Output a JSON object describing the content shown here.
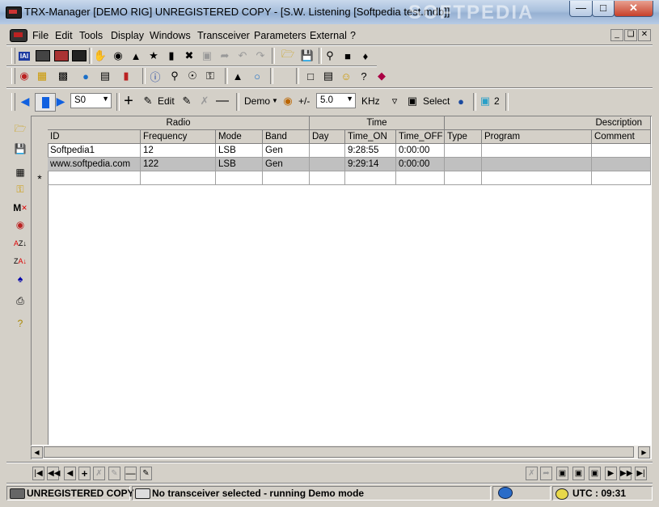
{
  "window": {
    "title": "TRX-Manager [DEMO RIG] UNREGISTERED COPY - [S.W. Listening [Softpedia test.mdb]]",
    "watermark": "SOFTPEDIA"
  },
  "menu": [
    "File",
    "Edit",
    "Tools",
    "Display",
    "Windows",
    "Transceiver",
    "Parameters",
    "External",
    "?"
  ],
  "toolbar3": {
    "memory_value": "S0",
    "edit_label": "Edit",
    "demo_label": "Demo",
    "plusminus_label": "+/-",
    "step_value": "5.0",
    "unit_label": "KHz",
    "select_label": "Select",
    "db_count": "2"
  },
  "grid": {
    "groups": [
      "Radio",
      "Time",
      "Description"
    ],
    "columns": [
      "ID",
      "Frequency",
      "Mode",
      "Band",
      "Day",
      "Time_ON",
      "Time_OFF",
      "Type",
      "Program",
      "Comment"
    ],
    "rows": [
      {
        "ID": "Softpedia1",
        "Frequency": "12",
        "Mode": "LSB",
        "Band": "Gen",
        "Day": "",
        "Time_ON": "9:28:55",
        "Time_OFF": "0:00:00",
        "Type": "",
        "Program": "",
        "Comment": ""
      },
      {
        "ID": "www.softpedia.com",
        "Frequency": "122",
        "Mode": "LSB",
        "Band": "Gen",
        "Day": "",
        "Time_ON": "9:29:14",
        "Time_OFF": "0:00:00",
        "Type": "",
        "Program": "",
        "Comment": ""
      }
    ],
    "new_row_marker": "*"
  },
  "status": {
    "registration": "UNREGISTERED COPY",
    "message": "No transceiver selected - running Demo mode",
    "utc": "UTC : 09:31"
  },
  "colors": {
    "accent_blue": "#1060e0",
    "selected_row": "#c0c0c0",
    "close_red": "#c7402a"
  }
}
